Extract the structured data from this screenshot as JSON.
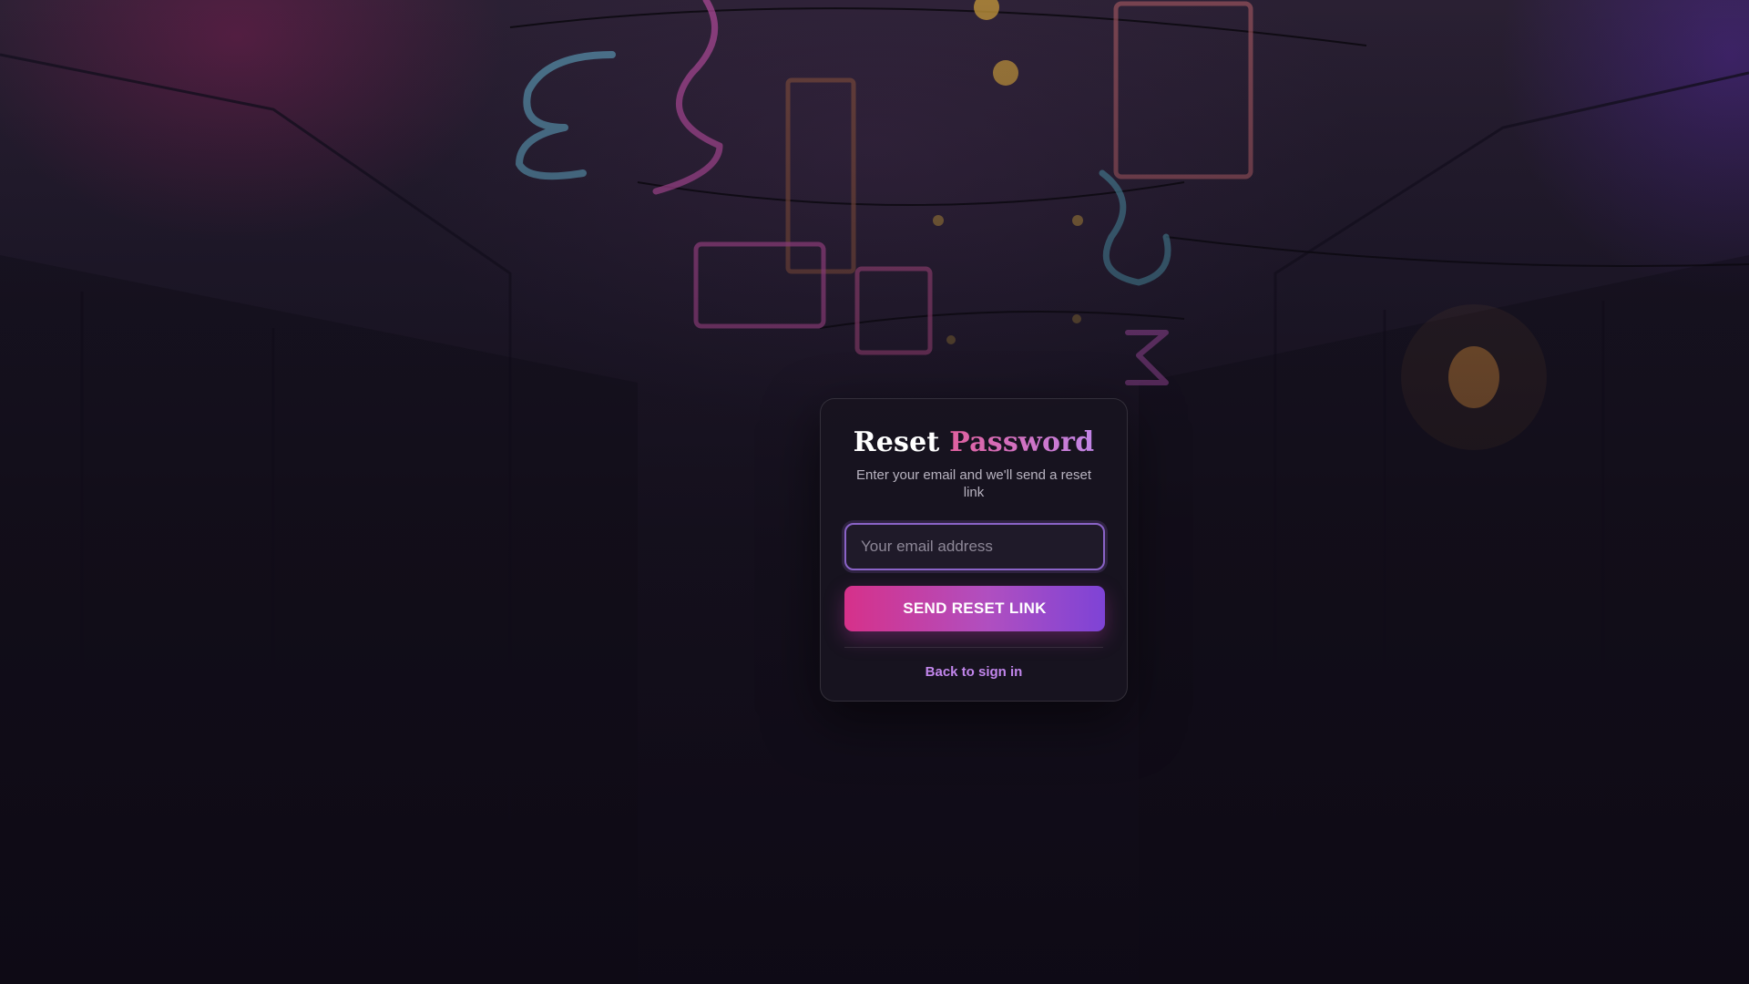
{
  "title": {
    "main": "Reset",
    "accent": "Password"
  },
  "subtitle": "Enter your email and we'll send a reset link",
  "email": {
    "placeholder": "Your email address",
    "value": ""
  },
  "send_button_label": "SEND RESET LINK",
  "back_link_label": "Back to sign in",
  "colors": {
    "accent_pink": "#d6318a",
    "accent_purple": "#7e43d6",
    "link": "#c286ec",
    "card_bg": "#181320"
  }
}
